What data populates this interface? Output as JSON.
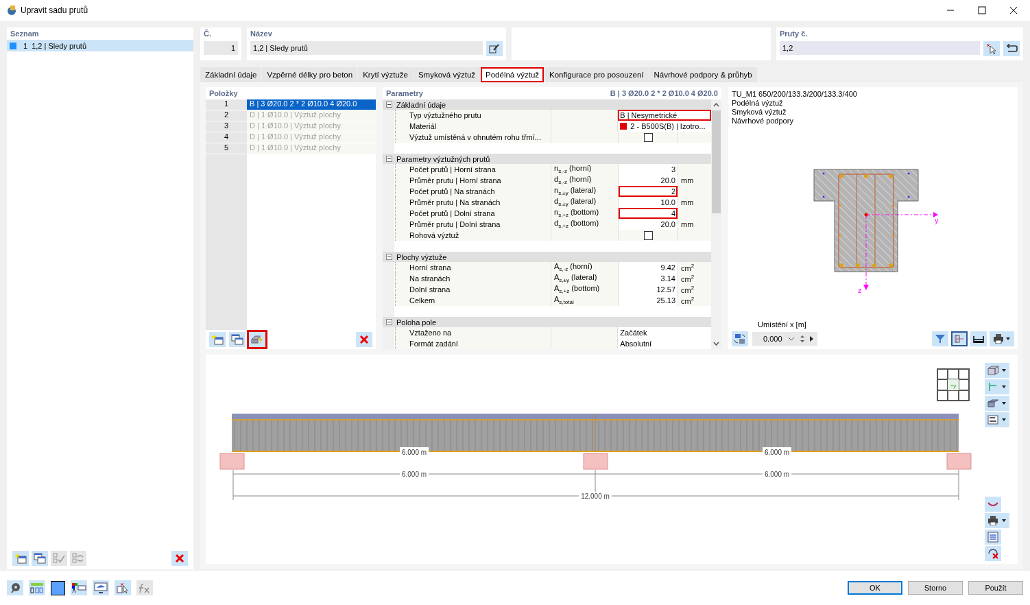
{
  "window": {
    "title": "Upravit sadu prutů"
  },
  "list": {
    "title": "Seznam",
    "items": [
      {
        "number": "1",
        "name": "1,2 | Sledy prutů",
        "color": "#1e90ff",
        "selected": true
      }
    ]
  },
  "header": {
    "number_label": "Č.",
    "number": "1",
    "name_label": "Název",
    "name": "1,2 | Sledy prutů",
    "members_label": "Pruty č.",
    "members": "1,2"
  },
  "tabs": [
    {
      "label": "Základní údaje",
      "selected": false,
      "highlighted": false
    },
    {
      "label": "Vzpěrné délky pro beton",
      "selected": false,
      "highlighted": false
    },
    {
      "label": "Krytí výztuže",
      "selected": false,
      "highlighted": false
    },
    {
      "label": "Smyková výztuž",
      "selected": false,
      "highlighted": false
    },
    {
      "label": "Podélná výztuž",
      "selected": true,
      "highlighted": true
    },
    {
      "label": "Konfigurace pro posouzení",
      "selected": false,
      "highlighted": false
    },
    {
      "label": "Návrhové podpory & průhyb",
      "selected": false,
      "highlighted": false
    }
  ],
  "items_panel": {
    "title": "Položky",
    "rows": [
      {
        "number": "1",
        "text": "B | 3 Ø20.0 2 * 2 Ø10.0 4 Ø20.0",
        "selected": true,
        "disabled": false
      },
      {
        "number": "2",
        "text": "D | 1 Ø10.0 | Výztuž plochy",
        "selected": false,
        "disabled": true
      },
      {
        "number": "3",
        "text": "D | 1 Ø10.0 | Výztuž plochy",
        "selected": false,
        "disabled": true
      },
      {
        "number": "4",
        "text": "D | 1 Ø10.0 | Výztuž plochy",
        "selected": false,
        "disabled": true
      },
      {
        "number": "5",
        "text": "D | 1 Ø10.0 | Výztuž plochy",
        "selected": false,
        "disabled": true
      }
    ],
    "tools": [
      {
        "kind": "new",
        "highlighted": false
      },
      {
        "kind": "copy",
        "highlighted": false
      },
      {
        "kind": "generate",
        "highlighted": true
      }
    ]
  },
  "parameters": {
    "title": "Parametry",
    "summary": "B | 3 Ø20.0 2 * 2 Ø10.0 4 Ø20.0",
    "groups": [
      {
        "title": "Základní údaje",
        "expanded": true,
        "rows": [
          {
            "kind": "text",
            "label": "Typ výztužného prutu",
            "value": "B | Nesymetrické",
            "highlighted": true
          },
          {
            "kind": "material",
            "label": "Materiál",
            "value": "2 - B500S(B) | Izotro...",
            "color": "#e00000"
          },
          {
            "kind": "checkbox",
            "label": "Výztuž umístěná v ohnutém rohu třmí...",
            "checked": false
          }
        ]
      },
      {
        "title": "Parametry výztužných prutů",
        "expanded": true,
        "rows": [
          {
            "kind": "number",
            "label": "Počet prutů | Horní strana",
            "symbol": "n$_{s,-z}$ (horní)",
            "value": "3",
            "highlighted": false
          },
          {
            "kind": "number",
            "label": "Průměr prutu | Horní strana",
            "symbol": "d$_{s,-z}$ (horní)",
            "value": "20.0",
            "unit": "mm",
            "highlighted": false
          },
          {
            "kind": "number",
            "label": "Počet prutů | Na stranách",
            "symbol": "n$_{s,±y}$ (lateral)",
            "value": "2",
            "highlighted": true
          },
          {
            "kind": "number",
            "label": "Průměr prutu | Na stranách",
            "symbol": "d$_{s,±y}$ (lateral)",
            "value": "10.0",
            "unit": "mm",
            "highlighted": false
          },
          {
            "kind": "number",
            "label": "Počet prutů | Dolní strana",
            "symbol": "n$_{s,+z}$ (bottom)",
            "value": "4",
            "highlighted": true
          },
          {
            "kind": "number",
            "label": "Průměr prutu | Dolní strana",
            "symbol": "d$_{s,+z}$ (bottom)",
            "value": "20.0",
            "unit": "mm",
            "highlighted": false
          },
          {
            "kind": "checkbox",
            "label": "Rohová výztuž",
            "checked": false
          }
        ]
      },
      {
        "title": "Plochy výztuže",
        "expanded": true,
        "rows": [
          {
            "kind": "number",
            "label": "Horní strana",
            "symbol": "A$_{s,-z}$ (horní)",
            "value": "9.42",
            "unit": "cm$^{2}$",
            "highlighted": false
          },
          {
            "kind": "number",
            "label": "Na stranách",
            "symbol": "A$_{s,±y}$ (lateral)",
            "value": "3.14",
            "unit": "cm$^{2}$",
            "highlighted": false
          },
          {
            "kind": "number",
            "label": "Dolní strana",
            "symbol": "A$_{s,+z}$ (bottom)",
            "value": "12.57",
            "unit": "cm$^{2}$",
            "highlighted": false
          },
          {
            "kind": "number",
            "label": "Celkem",
            "symbol": "A$_{s,total}$",
            "value": "25.13",
            "unit": "cm$^{2}$",
            "highlighted": false
          }
        ]
      },
      {
        "title": "Poloha pole",
        "expanded": true,
        "rows": [
          {
            "kind": "text",
            "label": "Vztaženo na",
            "value": "Začátek",
            "highlighted": false
          },
          {
            "kind": "text",
            "label": "Formát zadání",
            "value": "Absolutní",
            "highlighted": false
          }
        ]
      }
    ]
  },
  "preview": {
    "lines": [
      "TU_M1 650/200/133.3/200/133.3/400",
      "Podélná výztuž",
      "Smyková výztuž",
      "Návrhové podpory"
    ],
    "axis_y": "y",
    "axis_z": "z",
    "location_label": "Umístění x [m]",
    "location": "0.000"
  },
  "beam": {
    "span_labels": [
      "6.000 m",
      "6.000 m"
    ],
    "dimension_labels": [
      "6.000 m",
      "6.000 m"
    ],
    "total_label": "12.000 m",
    "view_cube_label": "+y"
  },
  "buttons": [
    {
      "label": "OK",
      "default": true
    },
    {
      "label": "Storno",
      "default": false
    },
    {
      "label": "Použít",
      "default": false
    }
  ]
}
